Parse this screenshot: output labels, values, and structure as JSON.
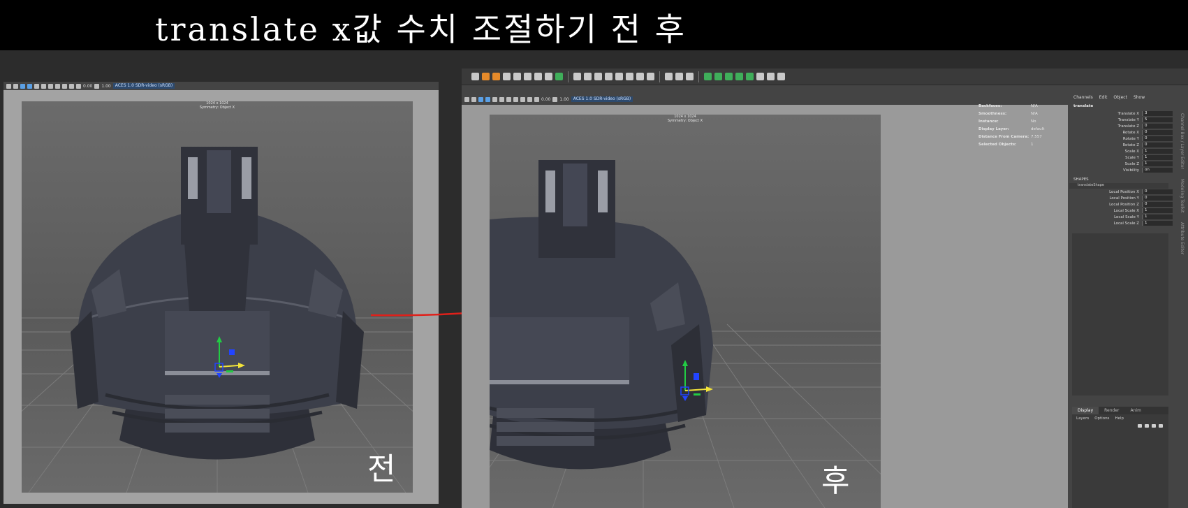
{
  "banner": {
    "title": "translate x값 수치 조절하기 전 후"
  },
  "viewport_left": {
    "toolbar_values": {
      "exposure": "0.00",
      "gamma": "1.00",
      "color_space": "ACES 1.0 SDR-video (sRGB)"
    },
    "resolution": "1024 x 1024",
    "symmetry": "Symmetry: Object X",
    "label": "전"
  },
  "viewport_right": {
    "toolbar_values": {
      "exposure": "0.00",
      "gamma": "1.00",
      "color_space": "ACES 1.0 SDR-video (sRGB)"
    },
    "resolution": "1024 x 1024",
    "symmetry": "Symmetry: Object X",
    "label": "후"
  },
  "hud": [
    {
      "label": "Backfaces:",
      "value": "N/A"
    },
    {
      "label": "Smoothness:",
      "value": "N/A"
    },
    {
      "label": "Instance:",
      "value": "No"
    },
    {
      "label": "Display Layer:",
      "value": "default"
    },
    {
      "label": "Distance From Camera:",
      "value": "7.557"
    },
    {
      "label": "Selected Objects:",
      "value": "1"
    }
  ],
  "channel_box": {
    "menu": [
      "Channels",
      "Edit",
      "Object",
      "Show"
    ],
    "object_name": "translate",
    "attributes": [
      {
        "label": "Translate X",
        "value": "3"
      },
      {
        "label": "Translate Y",
        "value": "5"
      },
      {
        "label": "Translate Z",
        "value": "0"
      },
      {
        "label": "Rotate X",
        "value": "0"
      },
      {
        "label": "Rotate Y",
        "value": "0"
      },
      {
        "label": "Rotate Z",
        "value": "0"
      },
      {
        "label": "Scale X",
        "value": "1"
      },
      {
        "label": "Scale Y",
        "value": "1"
      },
      {
        "label": "Scale Z",
        "value": "1"
      },
      {
        "label": "Visibility",
        "value": "on"
      }
    ],
    "shapes_header": "SHAPES",
    "shape_name": "translateShape",
    "shape_attributes": [
      {
        "label": "Local Position X",
        "value": "0"
      },
      {
        "label": "Local Position Y",
        "value": "0"
      },
      {
        "label": "Local Position Z",
        "value": "0"
      },
      {
        "label": "Local Scale X",
        "value": "1"
      },
      {
        "label": "Local Scale Y",
        "value": "1"
      },
      {
        "label": "Local Scale Z",
        "value": "1"
      }
    ]
  },
  "layer_editor": {
    "tabs": [
      "Display",
      "Render",
      "Anim"
    ],
    "menu": [
      "Layers",
      "Options",
      "Help"
    ]
  },
  "side_tabs": [
    "Channel Box / Layer Editor",
    "Modeling Toolkit",
    "Attribute Editor"
  ],
  "colors": {
    "arrow": "#e0201a",
    "model": "#3c3f4a",
    "gizmo_y": "#22cc44",
    "gizmo_x": "#f2e33a",
    "gizmo_z": "#2244ff"
  }
}
